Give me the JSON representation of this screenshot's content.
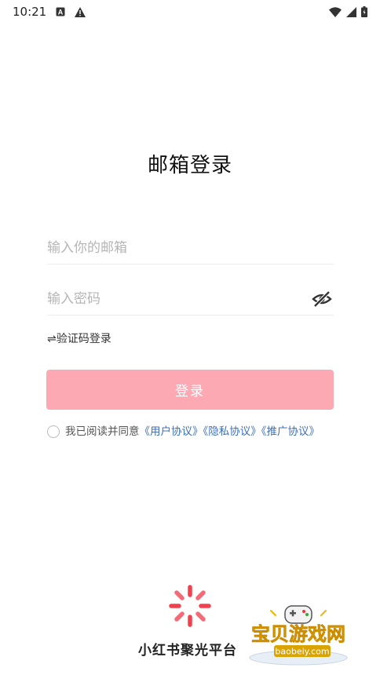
{
  "status_bar": {
    "time": "10:21",
    "left_icons": [
      "a-box-icon",
      "warning-icon"
    ],
    "right_icons": [
      "wifi-icon",
      "signal-icon",
      "battery-icon"
    ]
  },
  "page": {
    "title": "邮箱登录"
  },
  "form": {
    "email_placeholder": "输入你的邮箱",
    "email_value": "",
    "password_placeholder": "输入密码",
    "password_value": "",
    "code_login_label": "⇌验证码登录",
    "login_button": "登录"
  },
  "agreement": {
    "prefix": "我已阅读并同意",
    "user_agreement": "《用户协议》",
    "privacy_agreement": "《隐私协议》",
    "promo_agreement": "《推广协议》"
  },
  "brand": {
    "name": "小红书聚光平台"
  },
  "watermark": {
    "title": "宝贝游戏网",
    "url": "baobeiy.com"
  },
  "colors": {
    "accent": "#fda9b4",
    "link": "#3e6fb7",
    "brand_red": "#f0414f"
  }
}
